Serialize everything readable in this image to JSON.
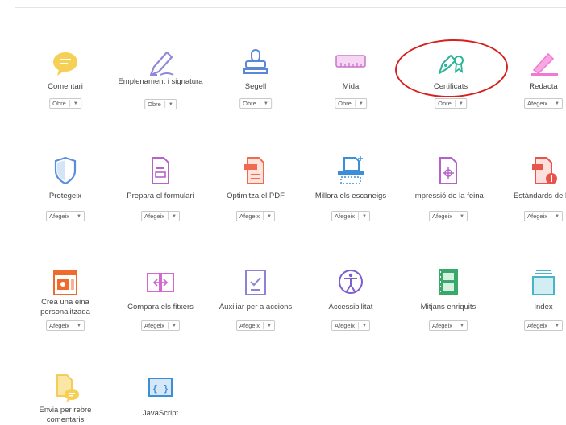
{
  "tools": {
    "comentari": {
      "label": "Comentari",
      "button": "Obre",
      "icon": "speech-bubble-icon",
      "color": "#f2c94c"
    },
    "emplenament": {
      "label": "Emplenament i signatura",
      "button": "Obre",
      "icon": "pen-sign-icon",
      "color": "#8a83d6"
    },
    "segell": {
      "label": "Segell",
      "button": "Obre",
      "icon": "stamp-icon",
      "color": "#5b88d6"
    },
    "mida": {
      "label": "Mida",
      "button": "Obre",
      "icon": "ruler-icon",
      "color": "#c775c9"
    },
    "certificats": {
      "label": "Certificats",
      "button": "Obre",
      "icon": "certificate-pen-icon",
      "color": "#2bb59a"
    },
    "redacta": {
      "label": "Redacta",
      "button": "Afegeix",
      "icon": "redact-marker-icon",
      "color": "#f07ad1"
    },
    "protegeix": {
      "label": "Protegeix",
      "button": "Afegeix",
      "icon": "shield-icon",
      "color": "#5a8de0"
    },
    "formulari": {
      "label": "Prepara el formulari",
      "button": "Afegeix",
      "icon": "form-icon",
      "color": "#b564c8"
    },
    "optimitza": {
      "label": "Optimitza el PDF",
      "button": "Afegeix",
      "icon": "optimize-pdf-icon",
      "color": "#f06a4f"
    },
    "escaneigs": {
      "label": "Millora els escaneigs",
      "button": "Afegeix",
      "icon": "scan-icon",
      "color": "#3b8fd9"
    },
    "impressio": {
      "label": "Impressió de la feina",
      "button": "Afegeix",
      "icon": "print-production-icon",
      "color": "#b463c4"
    },
    "estandards": {
      "label": "Estàndards de P",
      "button": "Afegeix",
      "icon": "pdf-standards-icon",
      "color": "#e8544a"
    },
    "einapers": {
      "label": "Crea una eina personalitzada",
      "button": "Afegeix",
      "icon": "custom-tool-icon",
      "color": "#f06a2c"
    },
    "compara": {
      "label": "Compara els fitxers",
      "button": "Afegeix",
      "icon": "compare-files-icon",
      "color": "#d467d1"
    },
    "auxiliar": {
      "label": "Auxiliar per a accions",
      "button": "Afegeix",
      "icon": "action-wizard-icon",
      "color": "#8a83d6"
    },
    "accessibilitat": {
      "label": "Accessibilitat",
      "button": "Afegeix",
      "icon": "accessibility-icon",
      "color": "#7c5fd1"
    },
    "mitjans": {
      "label": "Mitjans enriquits",
      "button": "Afegeix",
      "icon": "rich-media-icon",
      "color": "#39a96b"
    },
    "index": {
      "label": "Índex",
      "button": "Afegeix",
      "icon": "index-icon",
      "color": "#46b5c7"
    },
    "envia": {
      "label": "Envia per rebre comentaris",
      "button": "",
      "icon": "send-for-comments-icon",
      "color": "#f2c94c"
    },
    "javascript": {
      "label": "JavaScript",
      "button": "",
      "icon": "javascript-icon",
      "color": "#3b8fd9"
    }
  }
}
